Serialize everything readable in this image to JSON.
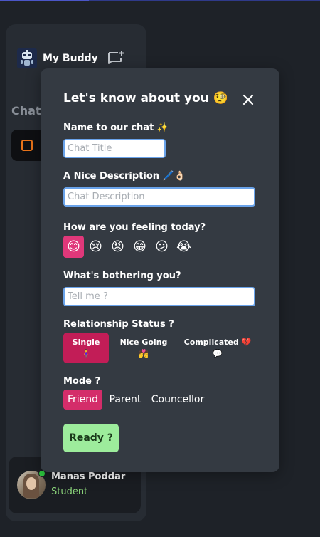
{
  "app": {
    "name": "My Buddy"
  },
  "sidebar": {
    "chats_label": "Chats",
    "user": {
      "name": "Manas Poddar",
      "role": "Student",
      "online": true
    }
  },
  "modal": {
    "title": "Let's know about you 🧐",
    "name_label": "Name to our chat ✨",
    "name_placeholder": "Chat Title",
    "description_label": "A Nice Description 🖊️👌🏻",
    "description_placeholder": "Chat Description",
    "feeling_label": "How are you feeling today?",
    "feelings": [
      "😊",
      "😢",
      "😡",
      "😁",
      "😕",
      "😭"
    ],
    "feelings_selected": "😊",
    "bothering_label": "What's bothering you?",
    "bothering_placeholder": "Tell me ?",
    "relationship_label": "Relationship Status ?",
    "relationship": [
      {
        "label": "Single",
        "emoji": "🧍‍♀️"
      },
      {
        "label": "Nice Going",
        "emoji": "💏"
      },
      {
        "label": "Complicated 💔",
        "emoji": "💬"
      }
    ],
    "relationship_selected": "Single",
    "mode_label": "Mode ?",
    "modes": [
      "Friend",
      "Parent",
      "Councellor"
    ],
    "mode_selected": "Friend",
    "ready_label": "Ready ?"
  },
  "colors": {
    "background": "#1e2228",
    "modal": "#343a42",
    "accent_pink": "#d42d6a",
    "ready_green": "#9dec9c",
    "role_green": "#8ad37a"
  }
}
